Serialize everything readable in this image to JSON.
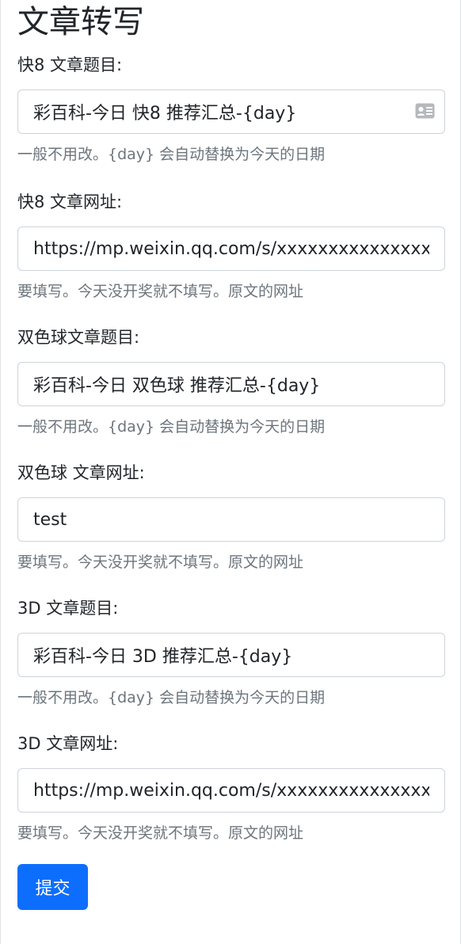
{
  "page": {
    "title": "文章转写"
  },
  "fields": [
    {
      "label": "快8 文章题目:",
      "value": "彩百科-今日 快8 推荐汇总-{day}",
      "help": "一般不用改。{day} 会自动替换为今天的日期",
      "icon": "contact-card-icon"
    },
    {
      "label": "快8 文章网址:",
      "value": "https://mp.weixin.qq.com/s/xxxxxxxxxxxxxxx",
      "help": "要填写。今天没开奖就不填写。原文的网址"
    },
    {
      "label": "双色球文章题目:",
      "value": "彩百科-今日 双色球 推荐汇总-{day}",
      "help": "一般不用改。{day} 会自动替换为今天的日期"
    },
    {
      "label": "双色球 文章网址:",
      "value": "test",
      "help": "要填写。今天没开奖就不填写。原文的网址"
    },
    {
      "label": "3D 文章题目:",
      "value": "彩百科-今日 3D 推荐汇总-{day}",
      "help": "一般不用改。{day} 会自动替换为今天的日期"
    },
    {
      "label": "3D 文章网址:",
      "value": "https://mp.weixin.qq.com/s/xxxxxxxxxxxxxxx",
      "help": "要填写。今天没开奖就不填写。原文的网址"
    }
  ],
  "submit": {
    "label": "提交"
  },
  "colors": {
    "primary": "#0d6efd",
    "muted_text": "#6c757d",
    "border": "#ced4da"
  }
}
